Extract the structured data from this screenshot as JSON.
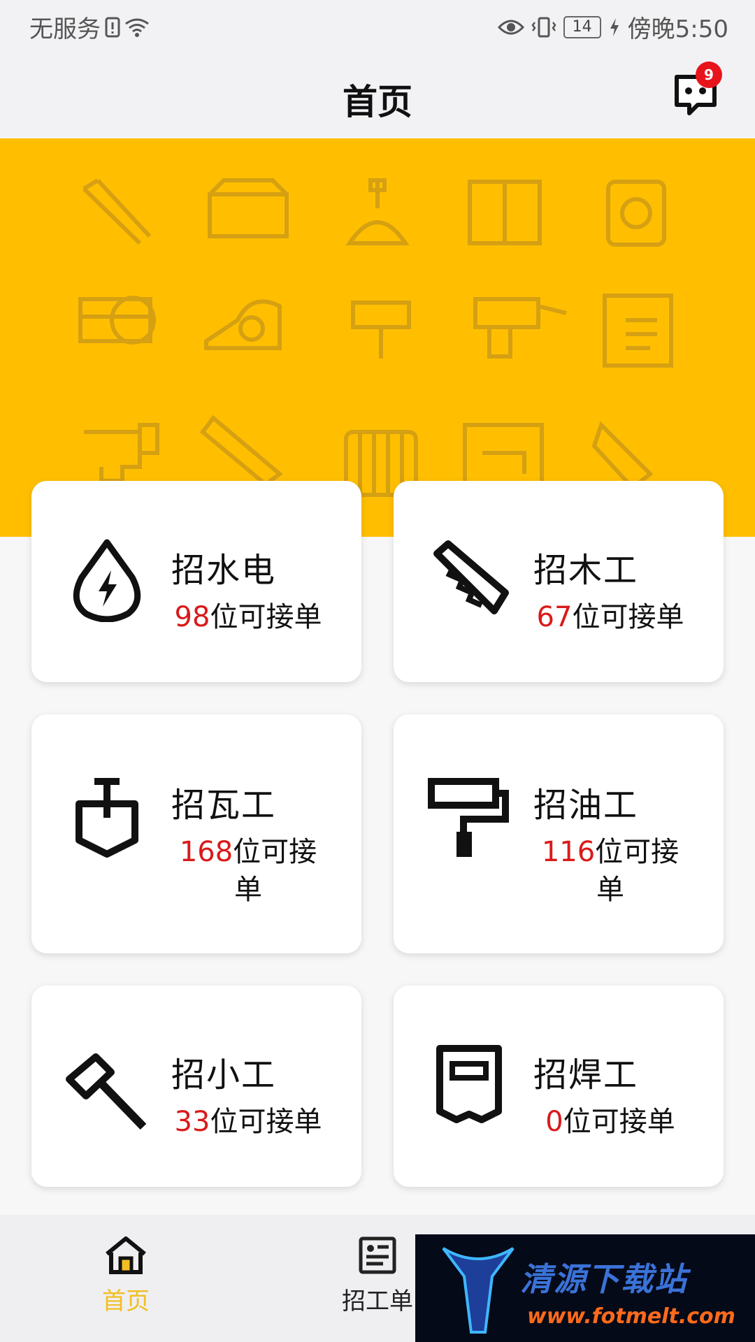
{
  "status_bar": {
    "carrier": "无服务",
    "time": "傍晚5:50",
    "battery": "14"
  },
  "header": {
    "title": "首页",
    "message_badge": "9"
  },
  "banner": {
    "color": "#ffbf00"
  },
  "cards": [
    {
      "title": "招水电",
      "count": "98",
      "suffix": "位可接单",
      "icon": "water-electric-icon"
    },
    {
      "title": "招木工",
      "count": "67",
      "suffix": "位可接单",
      "icon": "saw-icon"
    },
    {
      "title": "招瓦工",
      "count": "168",
      "suffix": "位可接单",
      "icon": "trowel-icon"
    },
    {
      "title": "招油工",
      "count": "116",
      "suffix": "位可接单",
      "icon": "paint-roller-icon"
    },
    {
      "title": "招小工",
      "count": "33",
      "suffix": "位可接单",
      "icon": "hammer-icon"
    },
    {
      "title": "招焊工",
      "count": "0",
      "suffix": "位可接单",
      "icon": "welding-mask-icon"
    }
  ],
  "bottom_nav": [
    {
      "label": "首页",
      "icon": "home-icon",
      "active": true
    },
    {
      "label": "招工单",
      "icon": "job-list-icon",
      "active": false
    }
  ],
  "watermark": {
    "text": "清源下载站",
    "url": "www.fotmelt.com"
  },
  "colors": {
    "accent": "#ffbf00",
    "count_red": "#d91a1a",
    "nav_active": "#f2be22",
    "badge_red": "#e8141c"
  }
}
